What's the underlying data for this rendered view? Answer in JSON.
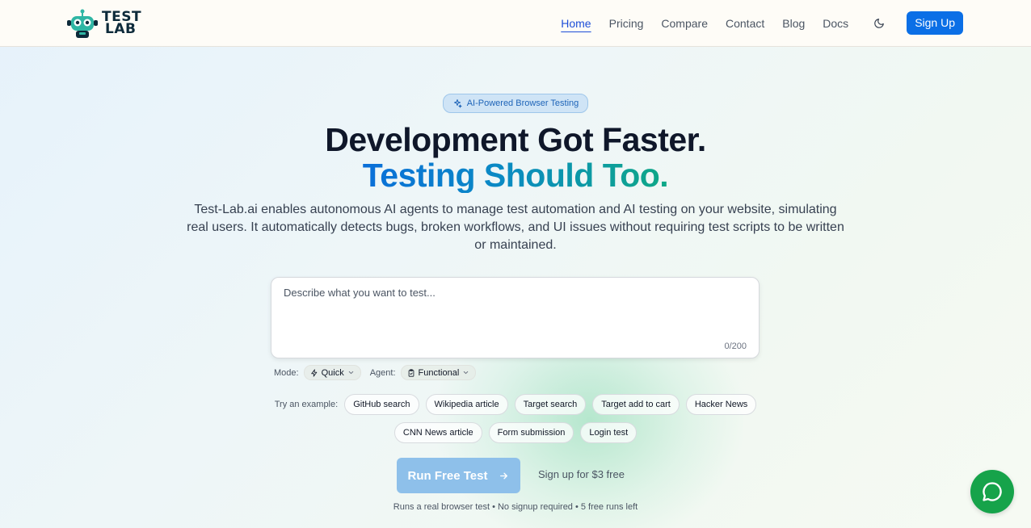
{
  "nav": {
    "logo_line1": "TEST",
    "logo_line2": "LAB",
    "links": [
      "Home",
      "Pricing",
      "Compare",
      "Contact",
      "Blog",
      "Docs"
    ],
    "signup": "Sign Up",
    "theme_icon": "moon-icon"
  },
  "hero": {
    "badge": "AI-Powered Browser Testing",
    "title_line1": "Development Got Faster.",
    "title_line2": "Testing Should Too.",
    "description": "Test-Lab.ai enables autonomous AI agents to manage test automation and AI testing on your website, simulating real users. It automatically detects bugs, broken workflows, and UI issues without requiring test scripts to be written or maintained."
  },
  "test_input": {
    "placeholder": "Describe what you want to test...",
    "value": "",
    "counter": "0/200"
  },
  "options": {
    "mode_label": "Mode:",
    "mode_value": "Quick",
    "agent_label": "Agent:",
    "agent_value": "Functional"
  },
  "examples": {
    "label": "Try an example:",
    "row1": [
      "GitHub search",
      "Wikipedia article",
      "Target search",
      "Target add to cart",
      "Hacker News"
    ],
    "row2": [
      "CNN News article",
      "Form submission",
      "Login test"
    ]
  },
  "cta": {
    "run": "Run Free Test",
    "signup_free": "Sign up for $3 free",
    "footnote": "Runs a real browser test • No signup required • 5 free runs left"
  },
  "colors": {
    "primary": "#0b6fe6",
    "run_button": "#8ec0ea",
    "chat": "#16a34a"
  }
}
